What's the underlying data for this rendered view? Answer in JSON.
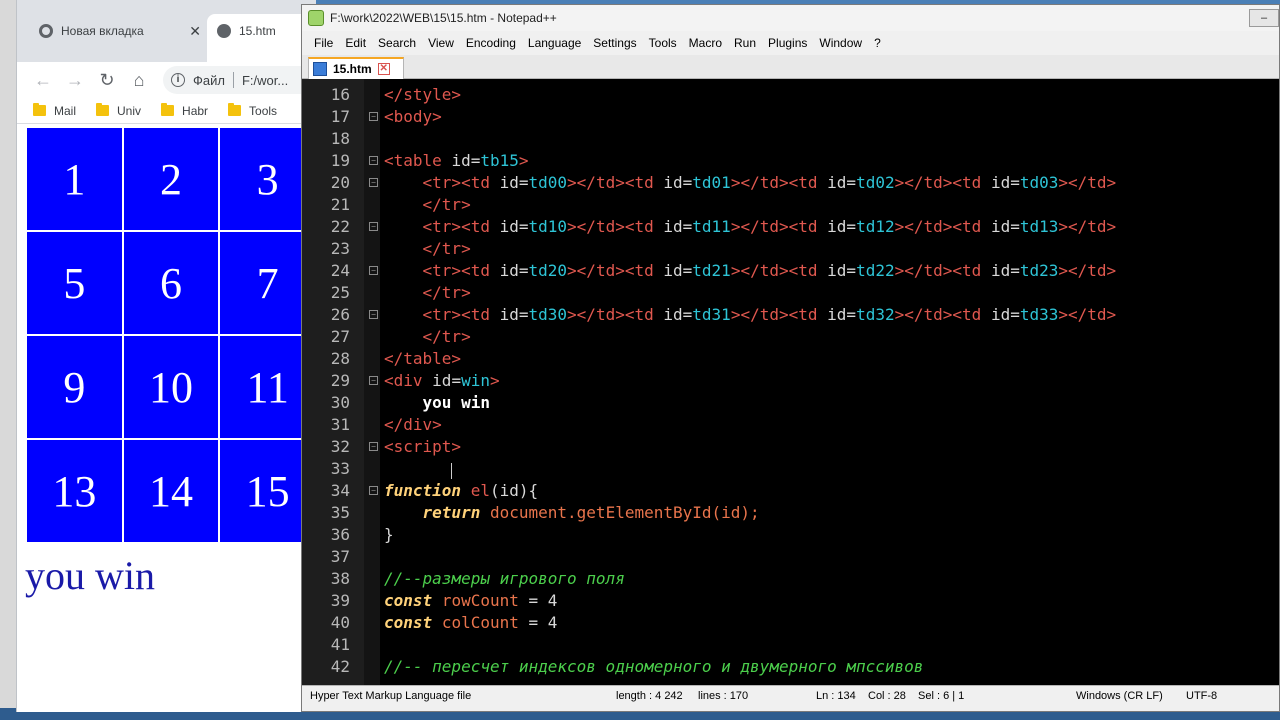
{
  "browser": {
    "tabs": [
      {
        "label": "Новая вкладка",
        "active": false
      },
      {
        "label": "15.htm",
        "active": true
      }
    ],
    "address": {
      "scheme_label": "Файл",
      "path": "F:/wor..."
    },
    "bookmarks": [
      "Mail",
      "Univ",
      "Habr",
      "Tools"
    ],
    "game_cells": [
      "1",
      "2",
      "3",
      "5",
      "6",
      "7",
      "9",
      "10",
      "11",
      "13",
      "14",
      "15"
    ],
    "win_text": "you win"
  },
  "npp": {
    "title": "F:\\work\\2022\\WEB\\15\\15.htm - Notepad++",
    "menu": [
      "File",
      "Edit",
      "Search",
      "View",
      "Encoding",
      "Language",
      "Settings",
      "Tools",
      "Macro",
      "Run",
      "Plugins",
      "Window",
      "?"
    ],
    "tab_label": "15.htm",
    "line_numbers": [
      "16",
      "17",
      "18",
      "19",
      "20",
      "21",
      "22",
      "23",
      "24",
      "25",
      "26",
      "27",
      "28",
      "29",
      "30",
      "31",
      "32",
      "33",
      "34",
      "35",
      "36",
      "37",
      "38",
      "39",
      "40",
      "41",
      "42"
    ],
    "status": {
      "lang": "Hyper Text Markup Language file",
      "length": "length : 4 242",
      "lines": "lines : 170",
      "ln": "Ln : 134",
      "col": "Col : 28",
      "sel": "Sel : 6 | 1",
      "eol": "Windows (CR LF)",
      "enc": "UTF-8"
    }
  },
  "code": {
    "l16": "</style>",
    "l17": "<body>",
    "l19a": "<table ",
    "l19b": "id",
    "l19c": "=",
    "l19d": "tb15",
    "l19e": ">",
    "tr": "<tr>",
    "tdo": "<td ",
    "id": "id",
    "eq": "=",
    "gt": ">",
    "tdc": "</td>",
    "trc": "</tr>",
    "r0": [
      "td00",
      "td01",
      "td02",
      "td03"
    ],
    "r1": [
      "td10",
      "td11",
      "td12",
      "td13"
    ],
    "r2": [
      "td20",
      "td21",
      "td22",
      "td23"
    ],
    "r3": [
      "td30",
      "td31",
      "td32",
      "td33"
    ],
    "l28": "</table>",
    "l29a": "<div ",
    "l29b": "id",
    "l29c": "=",
    "l29d": "win",
    "l29e": ">",
    "l30": "you win",
    "l31": "</div>",
    "l32": "<script>",
    "l34kw": "function",
    "l34fn": "el",
    "l34rest": "(id){",
    "l35kw": "return",
    "l35rest": "document.getElementById(id);",
    "l36": "}",
    "l38": "//--размеры игрового поля",
    "l39kw": "const",
    "l39id": "rowCount",
    "l39rest": " = 4",
    "l40kw": "const",
    "l40id": "colCount",
    "l40rest": " = 4",
    "l42": "//-- пересчет индексов одномерного и двумерного мпссивов"
  }
}
